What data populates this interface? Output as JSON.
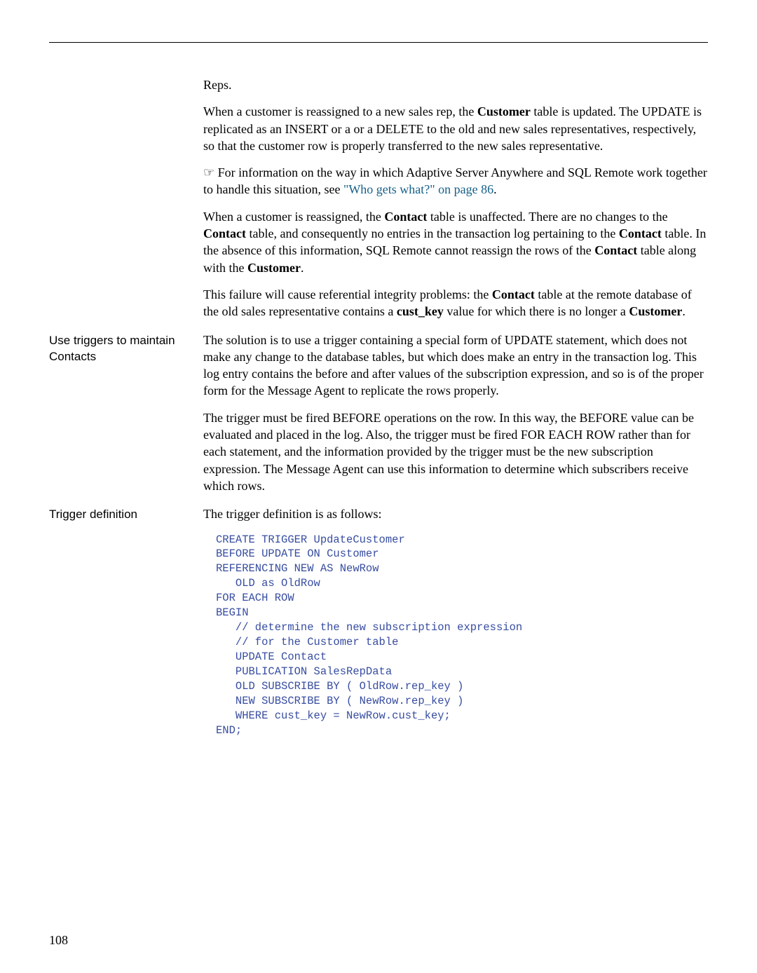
{
  "p1": "Reps.",
  "p2a": "When a customer is reassigned to a new sales rep, the ",
  "p2b": "Customer",
  "p2c": " table is updated. The UPDATE is replicated as an INSERT or a or a DELETE to the old and new sales representatives, respectively, so that the customer row is properly transferred to the new sales representative.",
  "p3a": "☞",
  "p3b": "  For information on the way in which Adaptive Server Anywhere and SQL Remote work together to handle this situation, see ",
  "p3c": "\"Who gets what?\" on page 86",
  "p3d": ".",
  "p4a": "When a customer is reassigned, the ",
  "p4b": "Contact",
  "p4c": " table is unaffected. There are no changes to the ",
  "p4d": "Contact",
  "p4e": " table, and consequently no entries in the transaction log pertaining to the ",
  "p4f": "Contact",
  "p4g": " table. In the absence of this information, SQL Remote cannot reassign the rows of the ",
  "p4h": "Contact",
  "p4i": " table along with the ",
  "p4j": "Customer",
  "p4k": ".",
  "p5a": "This failure will cause referential integrity problems: the ",
  "p5b": "Contact",
  "p5c": " table at the remote database of the old sales representative contains a ",
  "p5d": "cust_key",
  "p5e": " value for which there is no longer a ",
  "p5f": "Customer",
  "p5g": ".",
  "side1": "Use triggers to maintain Contacts",
  "p6": "The solution is to use a trigger containing a special form of UPDATE statement, which does not make any change to the database tables, but which does make an entry in the transaction log. This log entry contains the before and after values of the subscription expression, and so is of the proper form for the Message Agent to replicate the rows properly.",
  "p7": "The trigger must be fired BEFORE operations on the row. In this way, the BEFORE value can be evaluated and placed in the log. Also, the trigger must be fired FOR EACH ROW rather than for each statement, and the information provided by the trigger must be the new subscription expression. The Message Agent can use this information to determine which subscribers receive which rows.",
  "side2": "Trigger definition",
  "p8": "The trigger definition is as follows:",
  "code": "CREATE TRIGGER UpdateCustomer\nBEFORE UPDATE ON Customer\nREFERENCING NEW AS NewRow\n   OLD as OldRow\nFOR EACH ROW\nBEGIN\n   // determine the new subscription expression\n   // for the Customer table\n   UPDATE Contact\n   PUBLICATION SalesRepData\n   OLD SUBSCRIBE BY ( OldRow.rep_key )\n   NEW SUBSCRIBE BY ( NewRow.rep_key )\n   WHERE cust_key = NewRow.cust_key;\nEND;",
  "pageno": "108"
}
